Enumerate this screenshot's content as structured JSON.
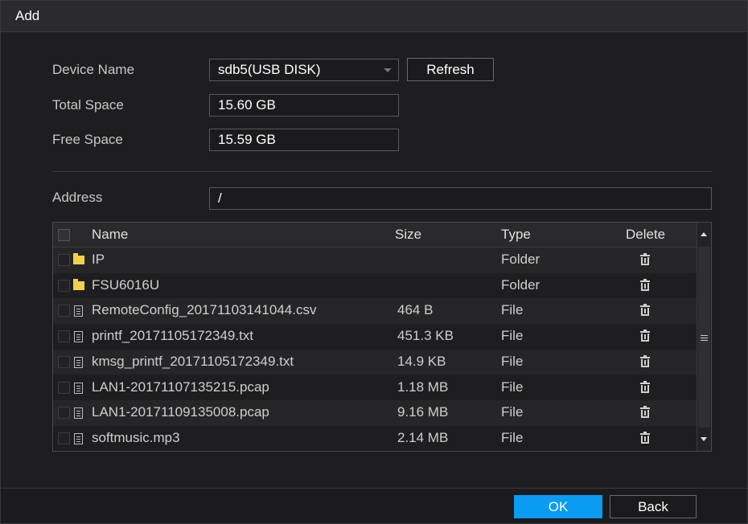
{
  "dialog": {
    "title": "Add"
  },
  "form": {
    "device_name_label": "Device Name",
    "device_name_value": "sdb5(USB DISK)",
    "refresh_label": "Refresh",
    "total_space_label": "Total Space",
    "total_space_value": "15.60 GB",
    "free_space_label": "Free Space",
    "free_space_value": "15.59 GB",
    "address_label": "Address",
    "address_value": "/"
  },
  "table": {
    "headers": {
      "name": "Name",
      "size": "Size",
      "type": "Type",
      "delete": "Delete"
    },
    "rows": [
      {
        "name": "IP",
        "size": "",
        "type": "Folder",
        "icon": "folder-icon"
      },
      {
        "name": "FSU6016U",
        "size": "",
        "type": "Folder",
        "icon": "folder-icon"
      },
      {
        "name": "RemoteConfig_20171103141044.csv",
        "size": "464 B",
        "type": "File",
        "icon": "file-icon"
      },
      {
        "name": "printf_20171105172349.txt",
        "size": "451.3 KB",
        "type": "File",
        "icon": "file-icon"
      },
      {
        "name": "kmsg_printf_20171105172349.txt",
        "size": "14.9 KB",
        "type": "File",
        "icon": "file-icon"
      },
      {
        "name": "LAN1-20171107135215.pcap",
        "size": "1.18 MB",
        "type": "File",
        "icon": "file-icon"
      },
      {
        "name": "LAN1-20171109135008.pcap",
        "size": "9.16 MB",
        "type": "File",
        "icon": "file-icon"
      },
      {
        "name": "softmusic.mp3",
        "size": "2.14 MB",
        "type": "File",
        "icon": "file-icon"
      }
    ]
  },
  "footer": {
    "ok_label": "OK",
    "back_label": "Back"
  },
  "colors": {
    "accent": "#0a9bf2",
    "folder": "#f2d14a",
    "background": "#1e1e20"
  }
}
